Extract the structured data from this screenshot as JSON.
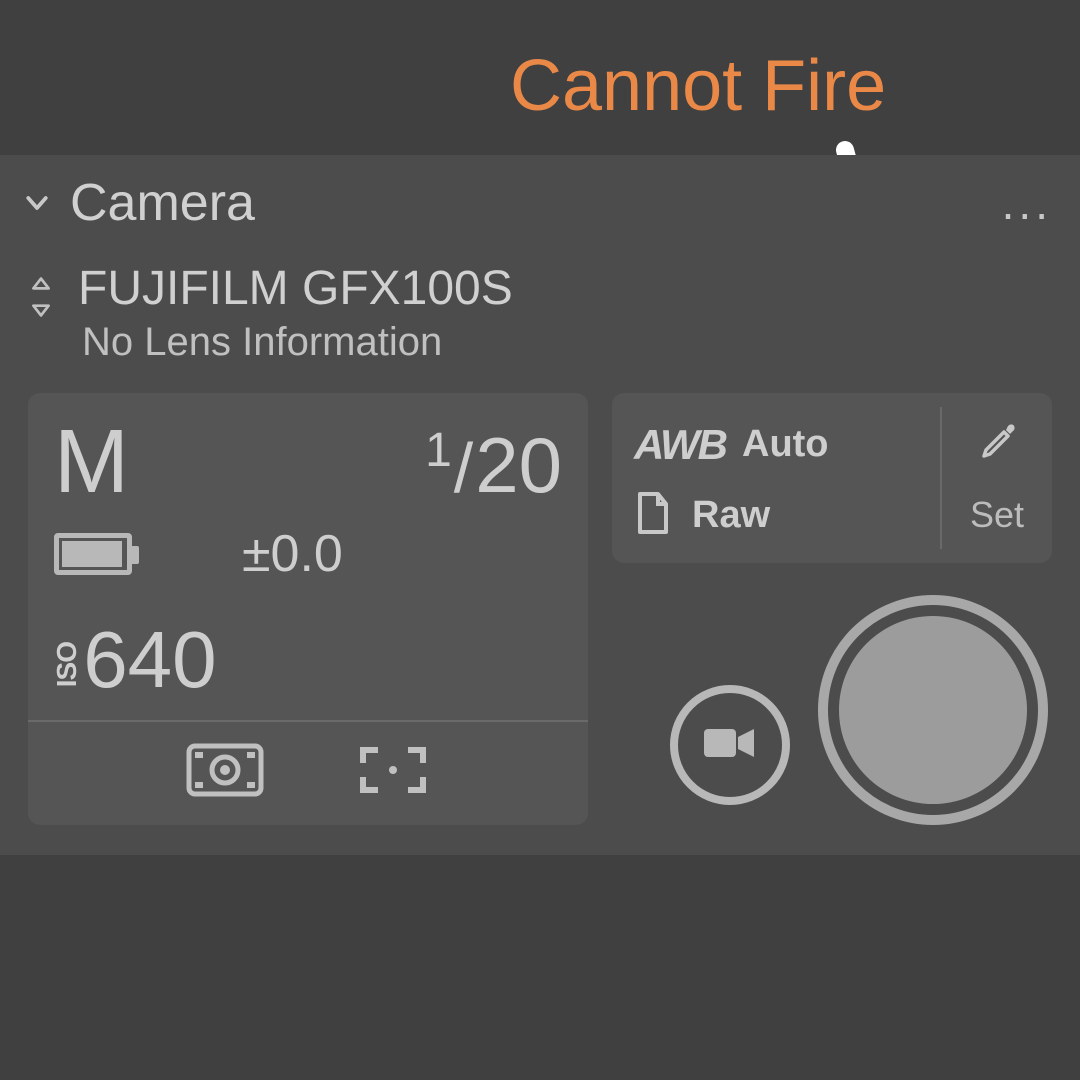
{
  "annotation": {
    "text": "Cannot Fire"
  },
  "panel": {
    "title": "Camera",
    "menu_dots": "..."
  },
  "camera": {
    "model": "FUJIFILM GFX100S",
    "lens_status": "No Lens Information"
  },
  "exposure": {
    "mode": "M",
    "shutter_numerator": "1",
    "shutter_denominator": "20",
    "ev_compensation": "±0.0",
    "iso_label": "ISO",
    "iso_value": "640"
  },
  "white_balance": {
    "awb_label": "AWB",
    "awb_mode": "Auto",
    "format": "Raw",
    "set_label": "Set"
  }
}
